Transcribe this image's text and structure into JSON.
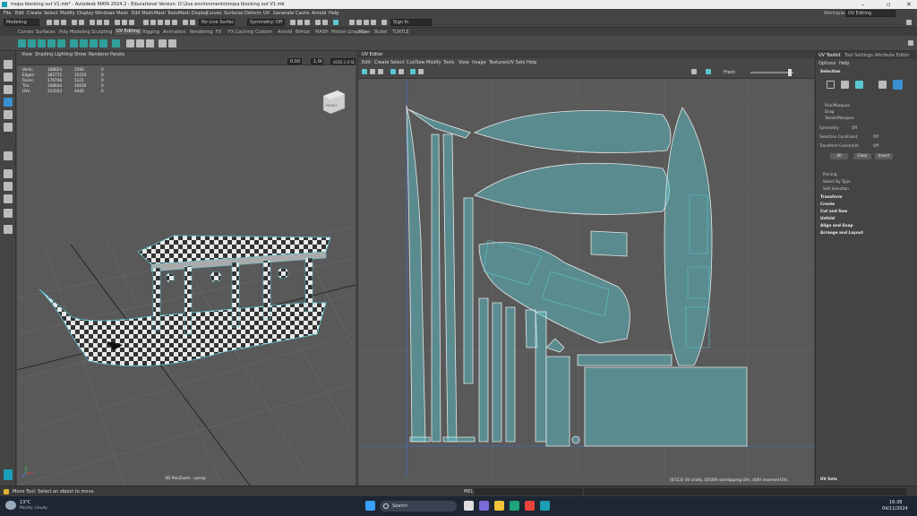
{
  "window": {
    "title": "mopa blocking out V1.mb* - Autodesk MAYA 2024.2 - Educational Version: D:\\2ue environments\\mopa blocking out V1.mb"
  },
  "menubar": {
    "items": [
      "File",
      "Edit",
      "Create",
      "Select",
      "Modify",
      "Display",
      "Windows",
      "Mesh",
      "Edit Mesh",
      "Mesh Tools",
      "Mesh Display",
      "Curves",
      "Surfaces",
      "Deform",
      "UV",
      "Generate",
      "Cache",
      "Arnold",
      "Help"
    ],
    "workspace_label": "Workspace :",
    "workspace_value": "UV Editing"
  },
  "statusline": {
    "menuset": "Modeling",
    "live_surface": "No Live Surface",
    "symmetry": "Symmetry: Off",
    "sign_in": "Sign In"
  },
  "shelf": {
    "tabs": [
      "Curves",
      "Surfaces",
      "Poly Modeling",
      "Sculpting",
      "UV Editing",
      "Rigging",
      "Animation",
      "Rendering",
      "FX",
      "FX Caching",
      "Custom",
      "Arnold",
      "Bifrost",
      "MASH",
      "Motion Graphics",
      "XGen",
      "Bullet",
      "TURTLE"
    ],
    "active_tab": "UV Editing"
  },
  "viewport": {
    "menu": [
      "View",
      "Shading",
      "Lighting",
      "Show",
      "Renderer",
      "Panels"
    ],
    "exposure": "0.00",
    "gamma": "1.00",
    "color_space": "ACES 1.0 SDR-video (sRGB)",
    "hud": [
      {
        "label": "Verts:",
        "a": "188023",
        "b": "2560",
        "c": "0"
      },
      {
        "label": "Edges:",
        "a": "382772",
        "b": "10233",
        "c": "0"
      },
      {
        "label": "Faces:",
        "a": "176748",
        "b": "5121",
        "c": "0"
      },
      {
        "label": "Tris:",
        "a": "340644",
        "b": "10030",
        "c": "0"
      },
      {
        "label": "UVs:",
        "a": "224103",
        "b": "4442",
        "c": "0"
      }
    ],
    "camera_label": "3D PanZoom : persp",
    "view_cube_label": "FRONT"
  },
  "uv_editor": {
    "title": "UV Editor",
    "menu": [
      "Edit",
      "Create",
      "Select",
      "Cut/Sew",
      "Modify",
      "Tools",
      "View",
      "Image",
      "Textures",
      "UV Sets",
      "Help"
    ],
    "texture_label": "Fresh",
    "status": "(0/113) UV shells, (0/509) overlapping UVs, (0/0) reversed UVs"
  },
  "uv_toolkit": {
    "tabs": [
      "UV Toolkit",
      "Tool Settings",
      "Attribute Editor"
    ],
    "menu": [
      "Options",
      "Help"
    ],
    "selection_header": "Selection",
    "modes": [
      "Pick/Marquee",
      "Drag",
      "Tweak/Marquee"
    ],
    "symmetry_label": "Symmetry",
    "symmetry_value": "Off",
    "selection_constraint_label": "Selection Constraint",
    "selection_constraint_value": "Off",
    "transform_constraint_label": "Transform Constraint",
    "transform_constraint_value": "Off",
    "buttons": [
      "All",
      "Clear",
      "Invert"
    ],
    "subsections": [
      "Pinning",
      "Select By Type",
      "Soft Selection"
    ],
    "sections": [
      "Transform",
      "Create",
      "Cut and Sew",
      "Unfold",
      "Align and Snap",
      "Arrange and Layout"
    ],
    "uv_sets": "UV Sets"
  },
  "helpline": {
    "text": "Move Tool: Select an object to move.",
    "mel_label": "MEL"
  },
  "taskbar": {
    "temperature": "13°C",
    "weather": "Mostly cloudy",
    "search": "Search",
    "time": "16:38",
    "date": "04/11/2024"
  },
  "colors": {
    "accent": "#2fa09b",
    "uv_shell_fill": "#5bc7d1",
    "uv_outline": "#e8e8e8",
    "viewport_bg": "#595959",
    "panel": "#444444",
    "taskbar": "#1e2633"
  }
}
